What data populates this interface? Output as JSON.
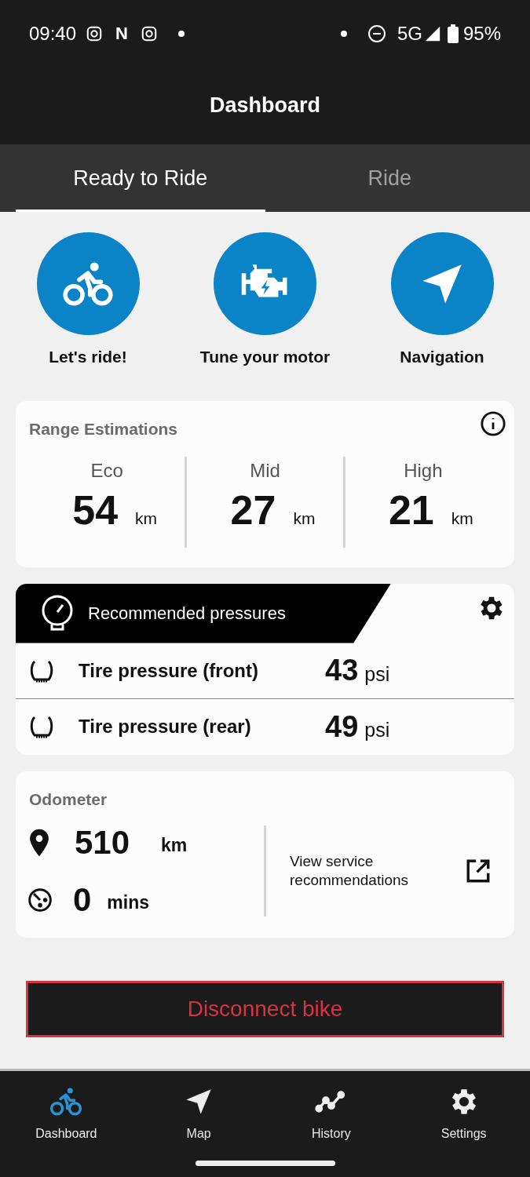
{
  "status_bar": {
    "time": "09:40",
    "app_letter": "N",
    "network": "5G",
    "battery": "95%"
  },
  "header": {
    "title": "Dashboard"
  },
  "tabs": [
    {
      "label": "Ready to Ride",
      "selected": true
    },
    {
      "label": "Ride",
      "selected": false
    }
  ],
  "quick_actions": [
    {
      "kind": "bike",
      "label": "Let's ride!"
    },
    {
      "kind": "engine",
      "label": "Tune your motor"
    },
    {
      "kind": "navigate",
      "label": "Navigation"
    }
  ],
  "range": {
    "title": "Range Estimations",
    "modes": [
      {
        "label": "Eco",
        "value": "54",
        "unit": "km"
      },
      {
        "label": "Mid",
        "value": "27",
        "unit": "km"
      },
      {
        "label": "High",
        "value": "21",
        "unit": "km"
      }
    ]
  },
  "pressures": {
    "title": "Recommended pressures",
    "rows": [
      {
        "label": "Tire pressure (front)",
        "value": "43",
        "unit": "psi"
      },
      {
        "label": "Tire pressure (rear)",
        "value": "49",
        "unit": "psi"
      }
    ]
  },
  "odometer": {
    "title": "Odometer",
    "distance": {
      "value": "510",
      "unit": "km"
    },
    "time": {
      "value": "0",
      "unit": "mins"
    },
    "link": "View service recommendations"
  },
  "disconnect_button": "Disconnect bike",
  "bottom_nav": [
    {
      "kind": "bike",
      "label": "Dashboard",
      "selected": true
    },
    {
      "kind": "navigate",
      "label": "Map",
      "selected": false
    },
    {
      "kind": "history",
      "label": "History",
      "selected": false
    },
    {
      "kind": "settings",
      "label": "Settings",
      "selected": false
    }
  ]
}
